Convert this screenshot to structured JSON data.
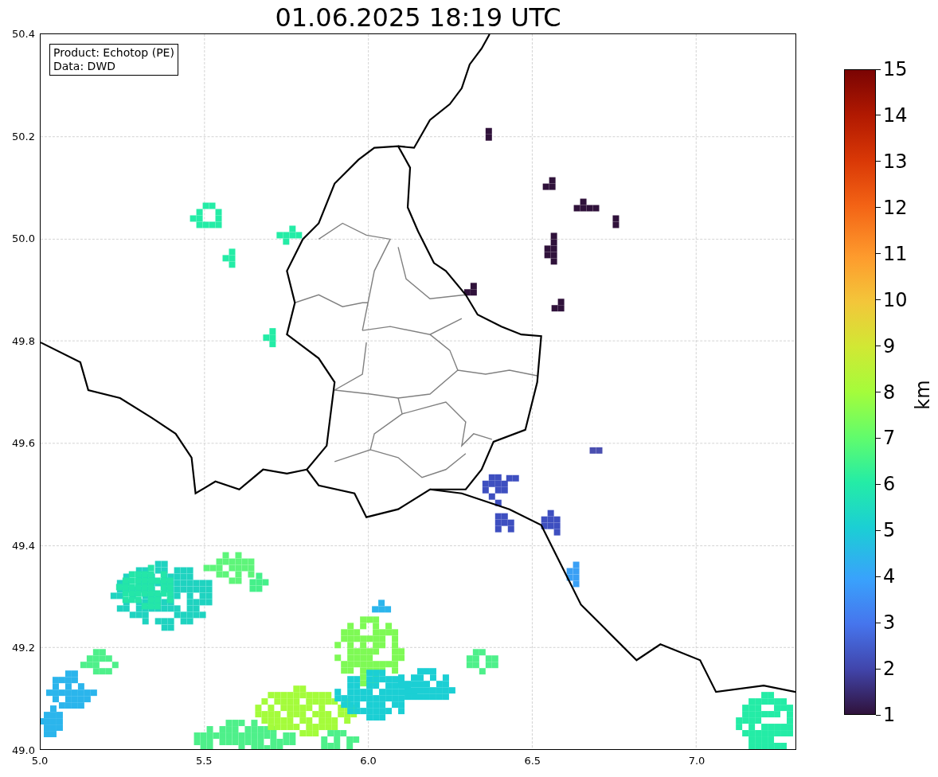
{
  "title": "01.06.2025 18:19 UTC",
  "legend": [
    "Product: Echotop (PE)",
    "Data: DWD"
  ],
  "map": {
    "x_ticks": [
      "5.0",
      "5.5",
      "6.0",
      "6.5",
      "7.0"
    ],
    "y_ticks": [
      "50.4",
      "50.2",
      "50.0",
      "49.8",
      "49.6",
      "49.4",
      "49.2",
      "49.0"
    ]
  },
  "colorbar": {
    "label": "km",
    "ticks": [
      "15",
      "14",
      "13",
      "12",
      "11",
      "10",
      "9",
      "8",
      "7",
      "6",
      "5",
      "4",
      "3",
      "2",
      "1"
    ]
  }
}
